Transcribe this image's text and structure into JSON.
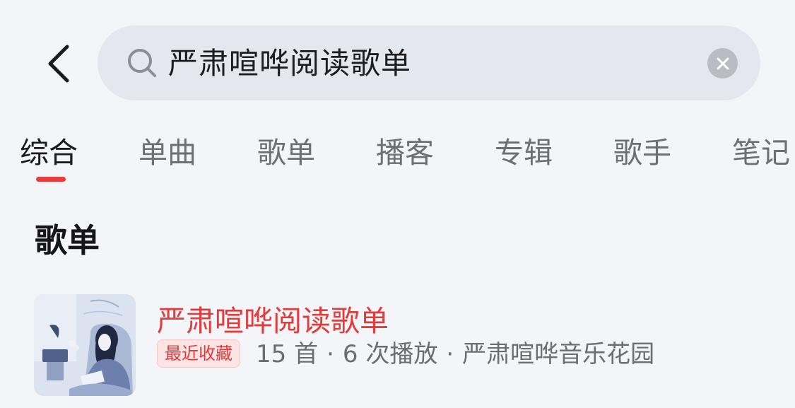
{
  "header": {
    "back_icon": "chevron-left-icon",
    "search": {
      "query": "严肃喧哗阅读歌单",
      "search_icon": "search-icon",
      "clear_icon": "clear-icon"
    }
  },
  "tabs": [
    {
      "label": "综合",
      "active": true
    },
    {
      "label": "单曲",
      "active": false
    },
    {
      "label": "歌单",
      "active": false
    },
    {
      "label": "播客",
      "active": false
    },
    {
      "label": "专辑",
      "active": false
    },
    {
      "label": "歌手",
      "active": false
    },
    {
      "label": "笔记",
      "active": false
    }
  ],
  "section": {
    "title": "歌单",
    "results": [
      {
        "title": "严肃喧哗阅读歌单",
        "badge": "最近收藏",
        "track_count": "15 首",
        "plays": "6 次播放",
        "creator": "严肃喧哗音乐花园",
        "separator": "·"
      }
    ]
  },
  "colors": {
    "accent": "#ea3a3a",
    "background": "#f3f5f9",
    "search_bg": "#e4e7ed"
  }
}
